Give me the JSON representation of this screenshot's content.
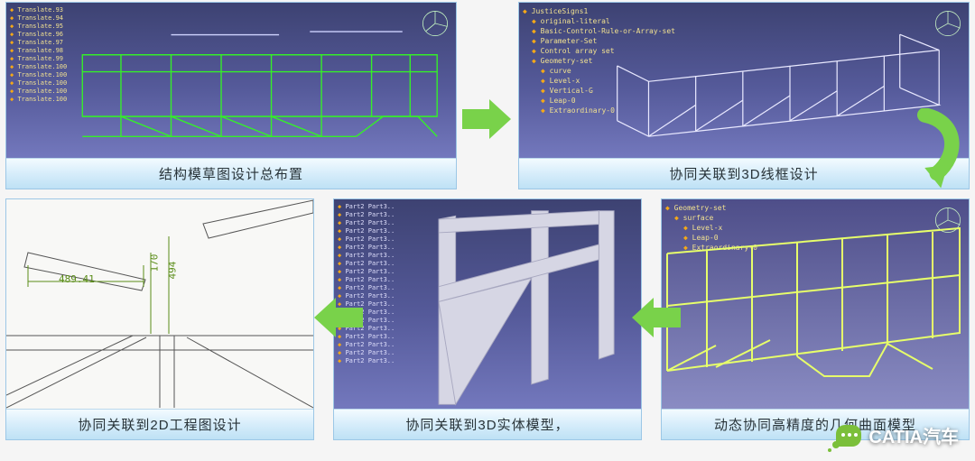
{
  "flow": {
    "step1": {
      "caption": "结构模草图设计总布置",
      "tree": [
        "Translate.93",
        "Translate.94",
        "Translate.95",
        "Translate.96",
        "Translate.97",
        "Translate.98",
        "Translate.99",
        "Translate.100",
        "Translate.100",
        "Translate.100",
        "Translate.100",
        "Translate.100"
      ]
    },
    "step2": {
      "caption": "协同关联到3D线框设计",
      "tree": [
        "JusticeSigns1",
        "original-literal",
        "Basic-Control-Rule-or-Array-set",
        "Parameter-Set",
        "Control array set",
        "Geometry-set",
        "curve",
        "Level-x",
        "Vertical-G",
        "Leap-0",
        "Extraordinary-0"
      ]
    },
    "step3": {
      "caption": "动态协同高精度的几何曲面模型",
      "tree": [
        "Geometry-set",
        "surface",
        "Level-x",
        "Leap-0",
        "Extraordinary-0"
      ]
    },
    "step4": {
      "caption": "协同关联到3D实体模型，",
      "tree": [
        "Part2 Part3..",
        "Part2 Part3..",
        "Part2 Part3..",
        "Part2 Part3..",
        "Part2 Part3..",
        "Part2 Part3..",
        "Part2 Part3..",
        "Part2 Part3..",
        "Part2 Part3..",
        "Part2 Part3..",
        "Part2 Part3..",
        "Part2 Part3..",
        "Part2 Part3..",
        "Part2 Part3..",
        "Part2 Part3..",
        "Part2 Part3..",
        "Part2 Part3..",
        "Part2 Part3..",
        "Part2 Part3..",
        "Part2 Part3.."
      ]
    },
    "step5": {
      "caption": "协同关联到2D工程图设计",
      "dims": {
        "d1": "489.41",
        "d2": "170",
        "d3": "494"
      }
    }
  },
  "watermark": "CATIA汽车"
}
